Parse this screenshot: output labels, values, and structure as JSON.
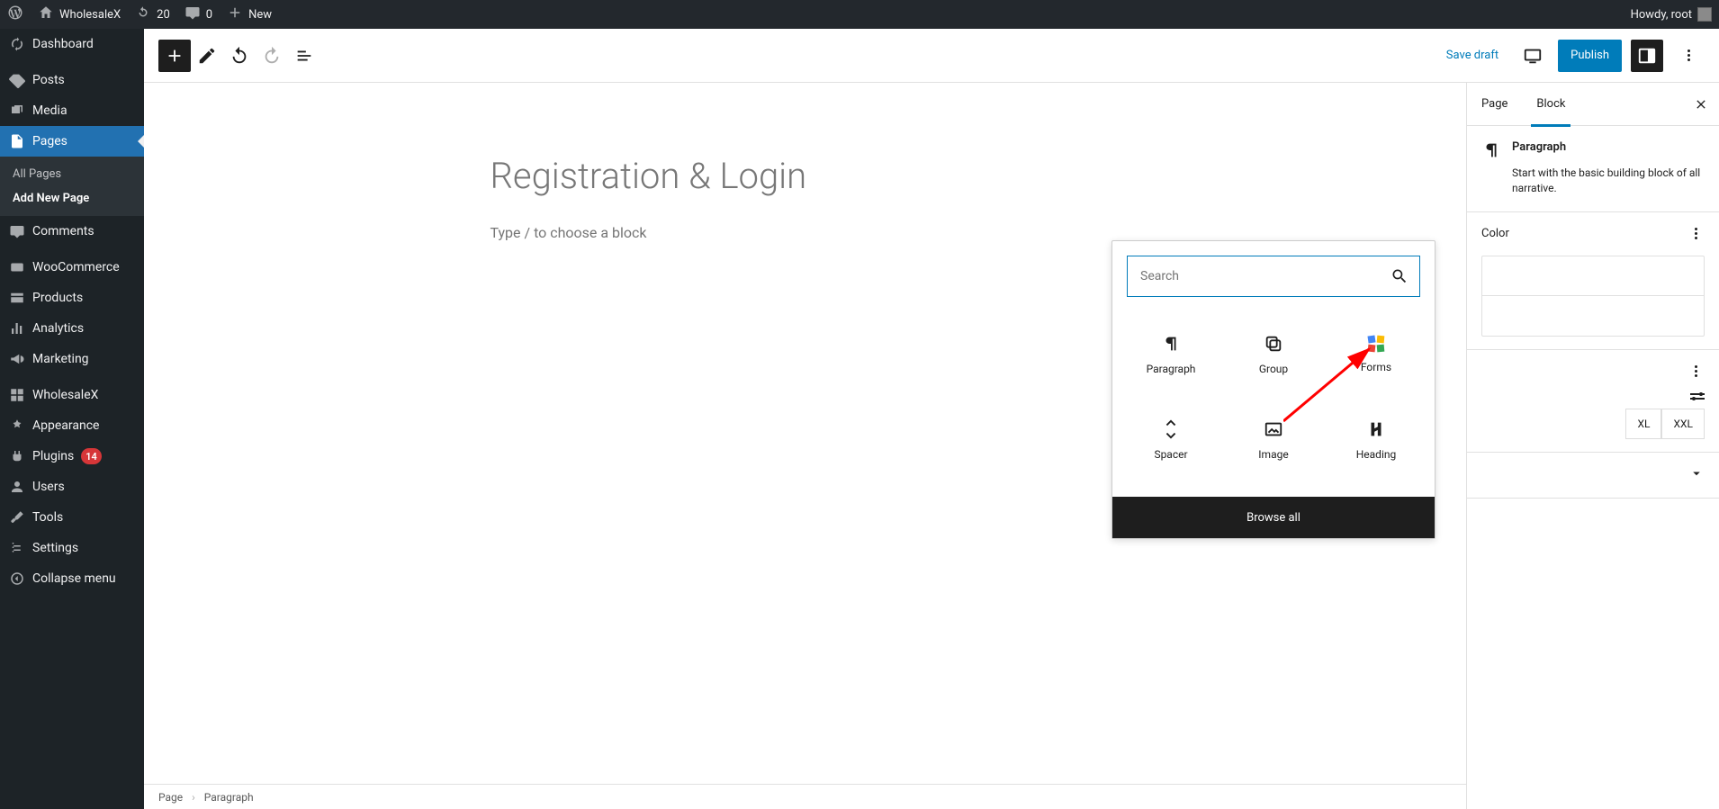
{
  "adminbar": {
    "site_name": "WholesaleX",
    "updates": "20",
    "comments": "0",
    "new_label": "New",
    "howdy": "Howdy, root"
  },
  "adminmenu": {
    "dashboard": "Dashboard",
    "posts": "Posts",
    "media": "Media",
    "pages": "Pages",
    "pages_sub_all": "All Pages",
    "pages_sub_add": "Add New Page",
    "comments": "Comments",
    "woocommerce": "WooCommerce",
    "products": "Products",
    "analytics": "Analytics",
    "marketing": "Marketing",
    "wholesalex": "WholesaleX",
    "appearance": "Appearance",
    "plugins": "Plugins",
    "plugins_badge": "14",
    "users": "Users",
    "tools": "Tools",
    "settings": "Settings",
    "collapse": "Collapse menu"
  },
  "toolbar": {
    "save_draft": "Save draft",
    "publish": "Publish"
  },
  "editor": {
    "title_placeholder": "Registration & Login",
    "block_placeholder": "Type / to choose a block"
  },
  "settings": {
    "tab_page": "Page",
    "tab_block": "Block",
    "block_name": "Paragraph",
    "block_desc": "Start with the basic building block of all narrative.",
    "color": "Color",
    "size_xl": "XL",
    "size_xxl": "XXL"
  },
  "popover": {
    "search_placeholder": "Search",
    "blocks": [
      {
        "label": "Paragraph"
      },
      {
        "label": "Group"
      },
      {
        "label": "Forms"
      },
      {
        "label": "Spacer"
      },
      {
        "label": "Image"
      },
      {
        "label": "Heading"
      }
    ],
    "browse_all": "Browse all"
  },
  "breadcrumb": {
    "page": "Page",
    "block": "Paragraph"
  }
}
